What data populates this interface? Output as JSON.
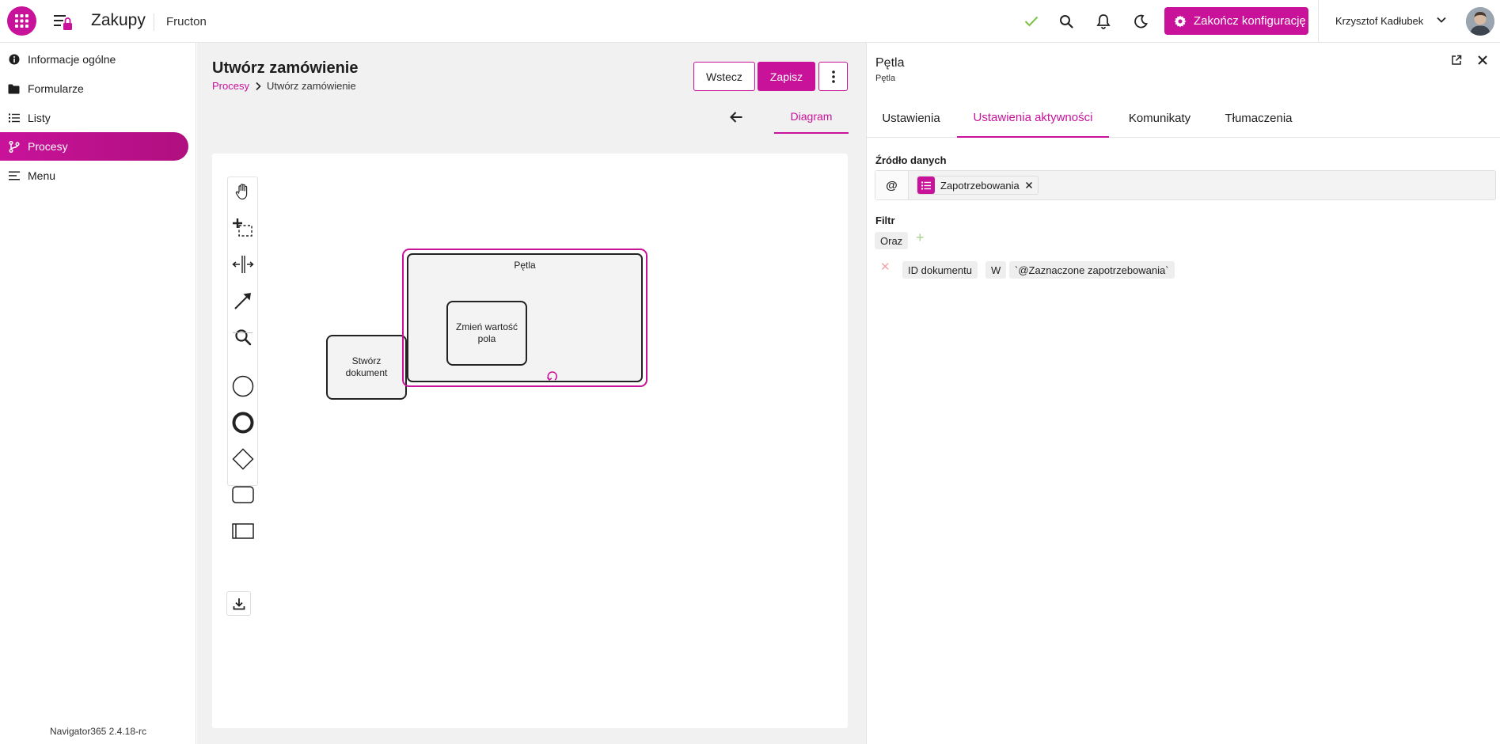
{
  "topbar": {
    "app_title": "Zakupy",
    "company": "Fructon",
    "finish_label": "Zakończ konfigurację",
    "user_name": "Krzysztof Kadłubek"
  },
  "sidebar": {
    "items": [
      {
        "label": "Informacje ogólne",
        "icon": "info-icon"
      },
      {
        "label": "Formularze",
        "icon": "folder-icon"
      },
      {
        "label": "Listy",
        "icon": "list-icon"
      },
      {
        "label": "Procesy",
        "icon": "branch-icon"
      },
      {
        "label": "Menu",
        "icon": "menu-icon"
      }
    ],
    "active_index": 3,
    "version": "Navigator365 2.4.18-rc"
  },
  "main": {
    "title": "Utwórz zamówienie",
    "breadcrumb_link": "Procesy",
    "breadcrumb_current": "Utwórz zamówienie",
    "back_label": "Wstecz",
    "save_label": "Zapisz",
    "diagram_tab": "Diagram"
  },
  "diagram": {
    "task1": "Stwórz dokument",
    "subprocess_label": "Pętla",
    "task2": "Zmień wartość pola"
  },
  "panel": {
    "title": "Pętla",
    "subtitle": "Pętla",
    "tabs": [
      "Ustawienia",
      "Ustawienia aktywności",
      "Komunikaty",
      "Tłumaczenia"
    ],
    "active_tab": 1,
    "source_label": "Źródło danych",
    "source_prefix": "@",
    "source_chip": "Zapotrzebowania",
    "filter_label": "Filtr",
    "filter_op": "Oraz",
    "filter_field": "ID dokumentu",
    "filter_operator": "W",
    "filter_value": "`@Zaznaczone zapotrzebowania`"
  },
  "colors": {
    "accent": "#c8129a",
    "check": "#7cc242"
  }
}
